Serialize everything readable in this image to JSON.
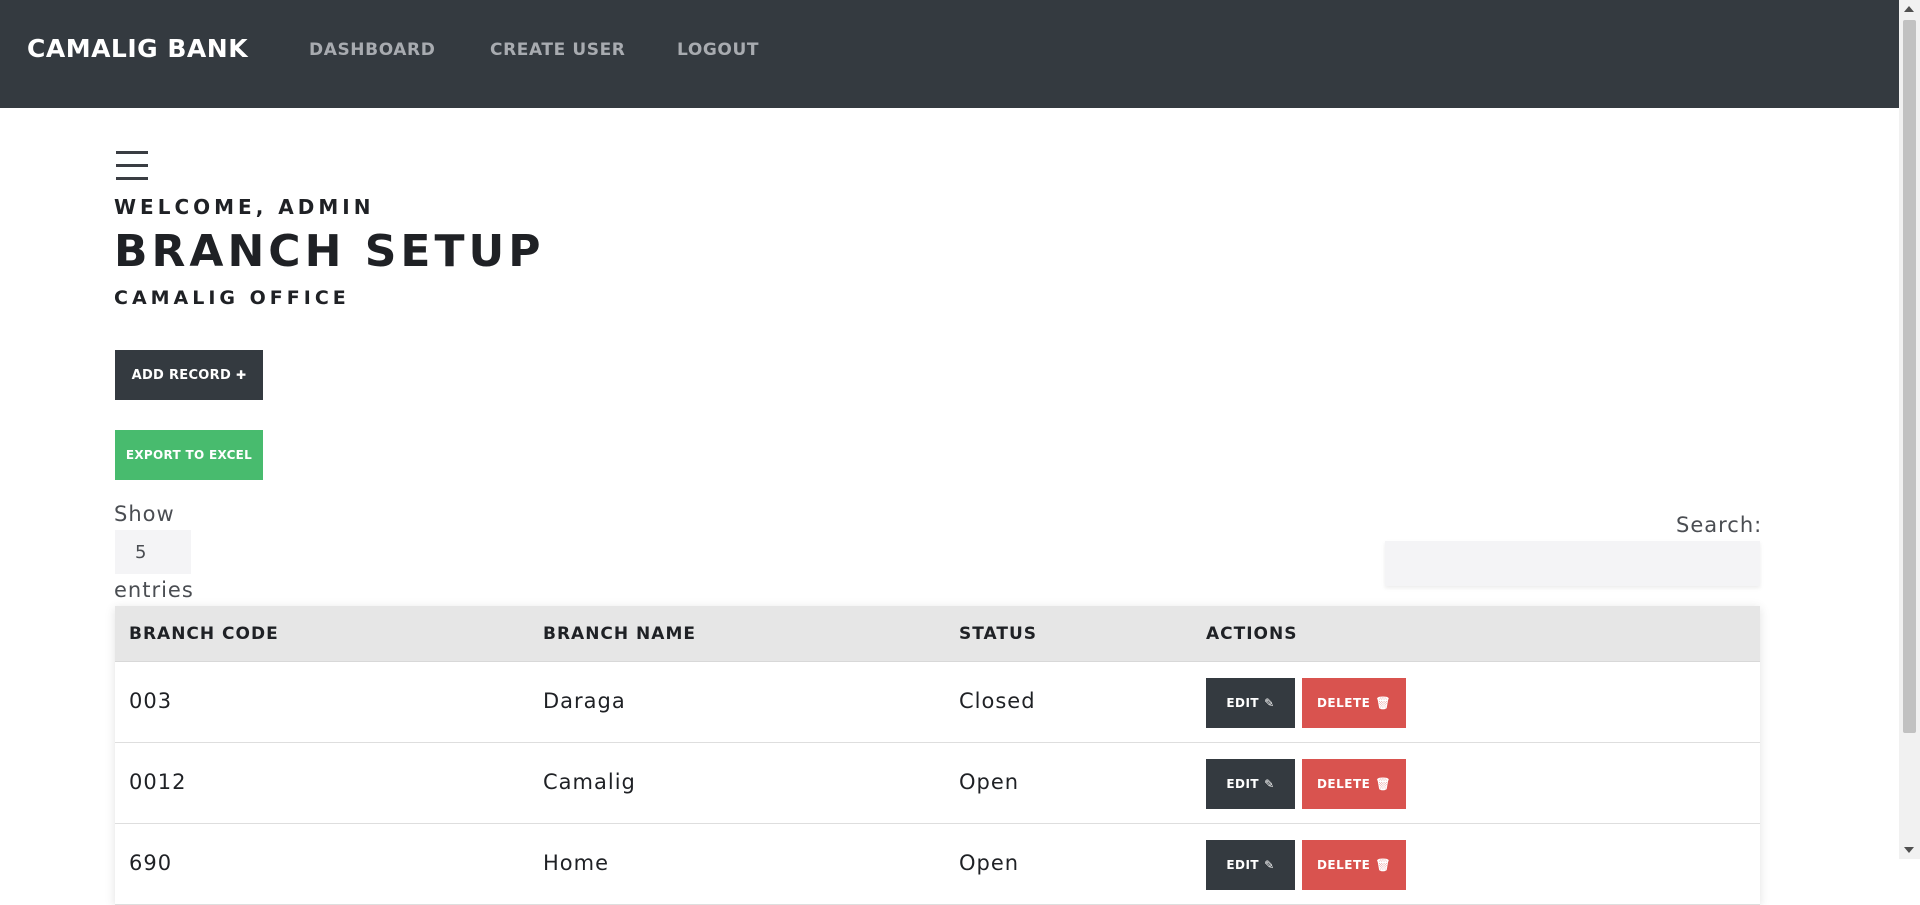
{
  "navbar": {
    "brand": "CAMALIG BANK",
    "links": [
      "DASHBOARD",
      "CREATE USER",
      "LOGOUT"
    ]
  },
  "header": {
    "welcome": "WELCOME, ADMIN",
    "title": "BRANCH SETUP",
    "subtitle": "CAMALIG OFFICE"
  },
  "toolbar": {
    "add_label": "ADD RECORD",
    "add_icon": "✚",
    "export_label": "EXPORT TO EXCEL"
  },
  "table_controls": {
    "show_label": "Show",
    "page_length": "5",
    "entries_label": "entries",
    "search_label": "Search:",
    "search_value": ""
  },
  "table": {
    "columns": [
      "BRANCH CODE",
      "BRANCH NAME",
      "STATUS",
      "ACTIONS"
    ],
    "rows": [
      {
        "code": "003",
        "name": "Daraga",
        "status": "Closed"
      },
      {
        "code": "0012",
        "name": "Camalig",
        "status": "Open"
      },
      {
        "code": "690",
        "name": "Home",
        "status": "Open"
      }
    ],
    "edit_label": "EDIT",
    "edit_icon": "✎",
    "delete_label": "DELETE",
    "delete_icon": "🗑"
  },
  "icons": {
    "menu": "hamburger-icon",
    "edit": "edit-icon",
    "delete": "trash-icon",
    "add": "plus-icon"
  },
  "colors": {
    "navbar": "#343a40",
    "export": "#48bb6e",
    "delete": "#d9534f",
    "dark_button": "#343a40"
  }
}
